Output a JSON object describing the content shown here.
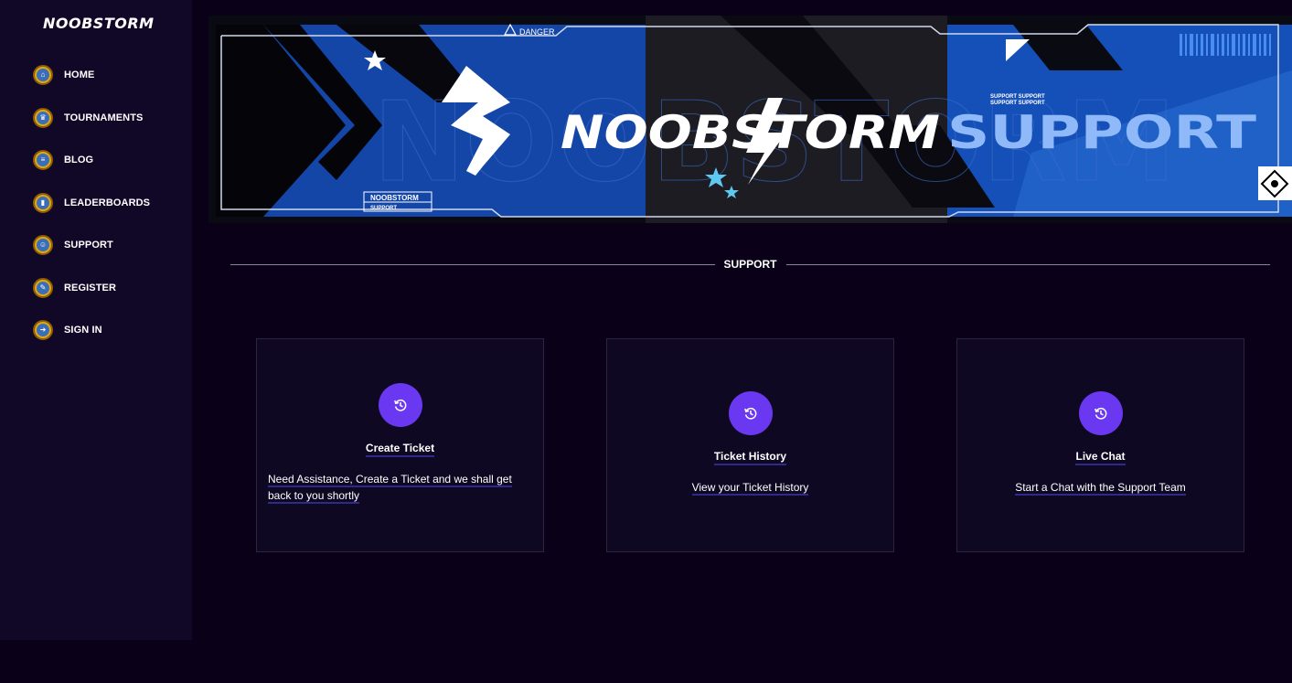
{
  "sidebar": {
    "logo": "NOOBSTORM",
    "items": [
      {
        "label": "HOME",
        "icon": "home-icon"
      },
      {
        "label": "TOURNAMENTS",
        "icon": "trophy-icon"
      },
      {
        "label": "BLOG",
        "icon": "blog-icon"
      },
      {
        "label": "LEADERBOARDS",
        "icon": "leaderboard-icon"
      },
      {
        "label": "SUPPORT",
        "icon": "support-icon"
      },
      {
        "label": "REGISTER",
        "icon": "register-icon"
      },
      {
        "label": "SIGN IN",
        "icon": "sign-in-icon"
      }
    ]
  },
  "banner": {
    "brand": "NOOBSTORM",
    "word": "SUPPORT",
    "danger": "DANGER",
    "tag_top": "NOOBSTORM",
    "tag_bottom": "SUPPORT",
    "mini_1": "SUPPORT SUPPORT",
    "mini_2": "SUPPORT SUPPORT"
  },
  "section": {
    "title": "SUPPORT"
  },
  "cards": [
    {
      "title": "Create Ticket",
      "desc_line1": "Need Assistance, Create a Ticket and we shall get",
      "desc_line2": "back to you shortly",
      "icon": "history-icon"
    },
    {
      "title": "Ticket History",
      "desc_line1": "View your Ticket History",
      "icon": "history-icon"
    },
    {
      "title": "Live Chat",
      "desc_line1": "Start a Chat with the Support Team",
      "icon": "history-icon"
    }
  ],
  "colors": {
    "background": "#0a0118",
    "sidebar": "#110726",
    "accent": "#6a38f0",
    "banner_blue": "#1446a8"
  }
}
